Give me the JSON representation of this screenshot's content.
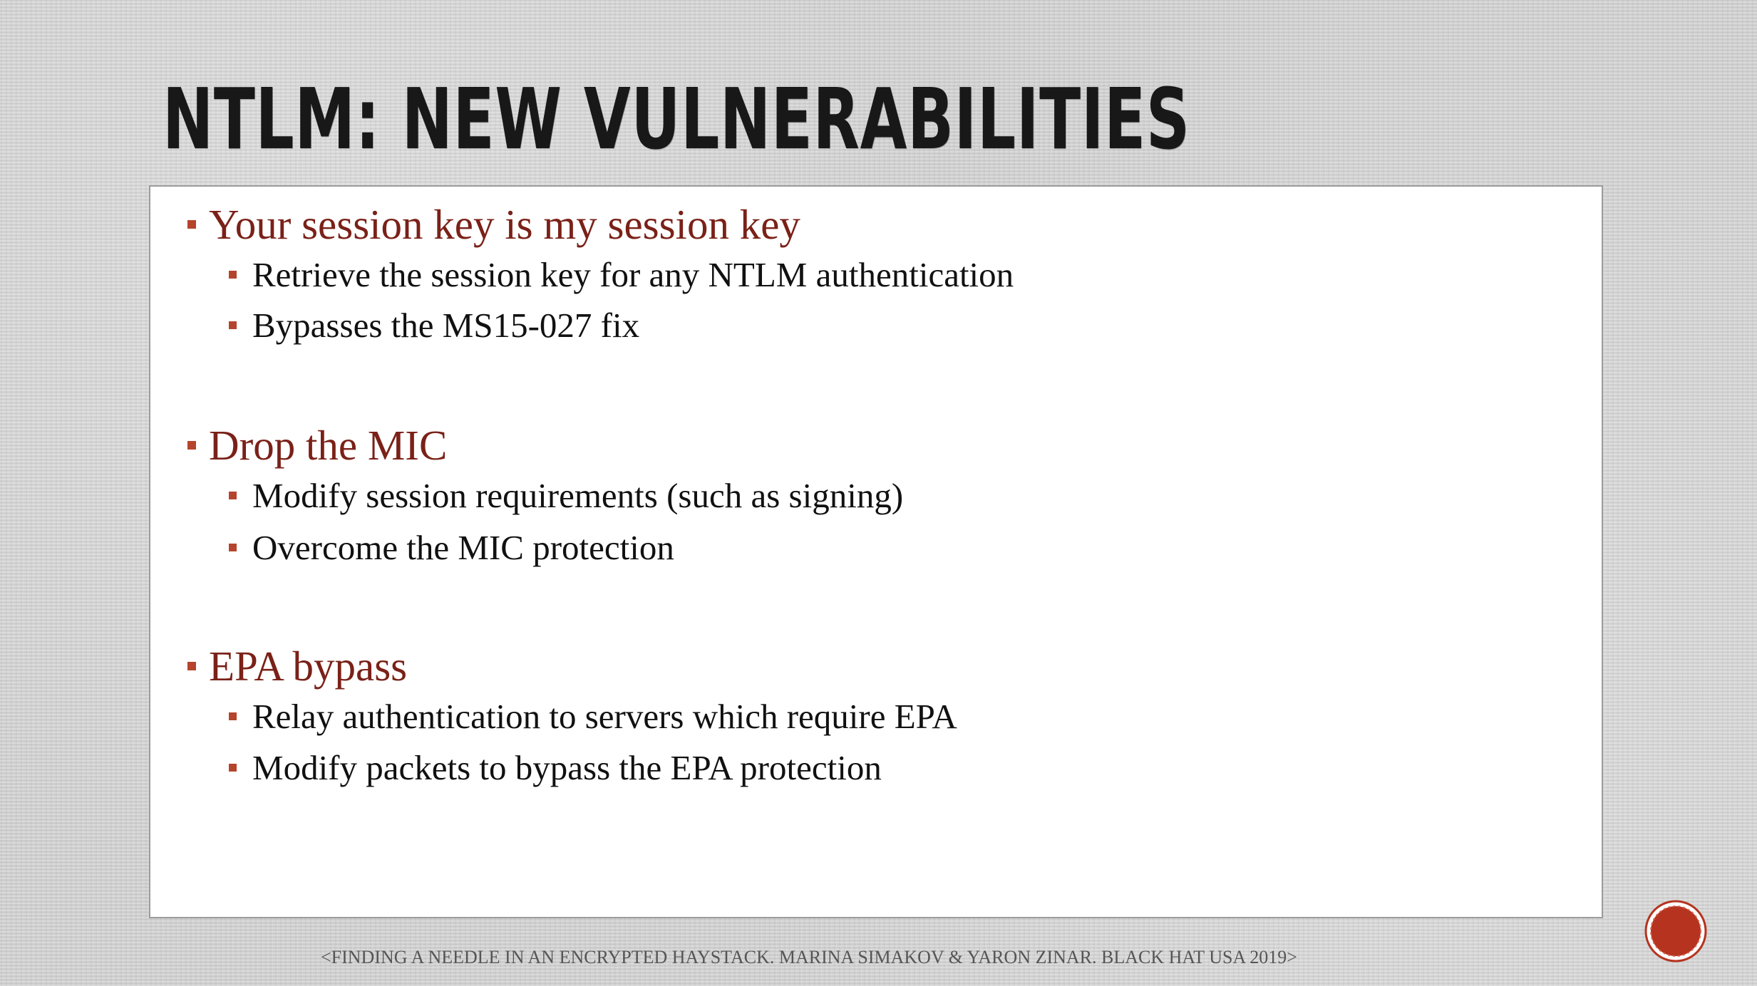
{
  "slide": {
    "title": "NTLM: NEW VULNERABILITIES",
    "sections": [
      {
        "heading": "Your session key is my session key",
        "points": [
          "Retrieve the session key for any NTLM authentication",
          "Bypasses the MS15-027 fix"
        ]
      },
      {
        "heading": "Drop the MIC",
        "points": [
          "Modify session requirements (such as signing)",
          "Overcome the MIC protection"
        ]
      },
      {
        "heading": "EPA bypass",
        "points": [
          "Relay authentication to servers which require EPA",
          "Modify packets to bypass the EPA protection"
        ]
      }
    ],
    "footer": "<FINDING A NEEDLE IN AN ENCRYPTED HAYSTACK. MARINA SIMAKOV & YARON ZINAR. BLACK HAT USA 2019>"
  },
  "colors": {
    "heading": "#7a2118",
    "bullet_marker": "#b5442c",
    "body_text": "#111111",
    "badge": "#b5331f"
  },
  "icons": {
    "slide_badge": "circle-badge-icon"
  }
}
